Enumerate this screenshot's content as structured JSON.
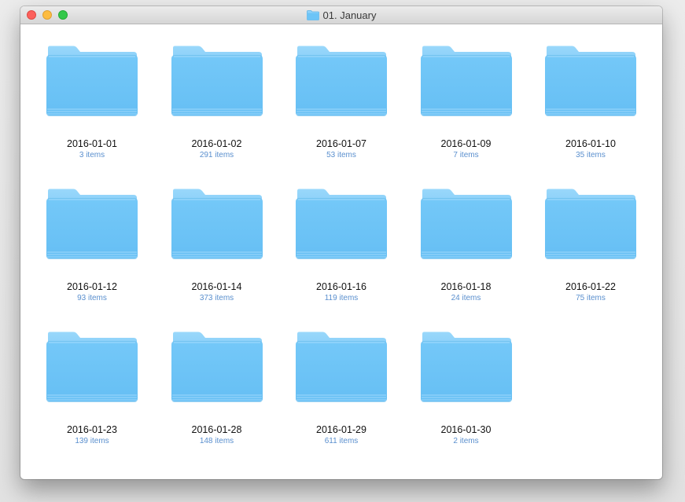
{
  "window": {
    "title": "01. January",
    "title_icon": "folder-icon"
  },
  "colors": {
    "folder_back": "#8fd2fa",
    "folder_front": "#6cc4f7",
    "item_count": "#5a8fce"
  },
  "items": [
    {
      "name": "2016-01-01",
      "count": "3 items"
    },
    {
      "name": "2016-01-02",
      "count": "291 items"
    },
    {
      "name": "2016-01-07",
      "count": "53 items"
    },
    {
      "name": "2016-01-09",
      "count": "7 items"
    },
    {
      "name": "2016-01-10",
      "count": "35 items"
    },
    {
      "name": "2016-01-12",
      "count": "93 items"
    },
    {
      "name": "2016-01-14",
      "count": "373 items"
    },
    {
      "name": "2016-01-16",
      "count": "119 items"
    },
    {
      "name": "2016-01-18",
      "count": "24 items"
    },
    {
      "name": "2016-01-22",
      "count": "75 items"
    },
    {
      "name": "2016-01-23",
      "count": "139 items"
    },
    {
      "name": "2016-01-28",
      "count": "148 items"
    },
    {
      "name": "2016-01-29",
      "count": "611 items"
    },
    {
      "name": "2016-01-30",
      "count": "2 items"
    }
  ]
}
